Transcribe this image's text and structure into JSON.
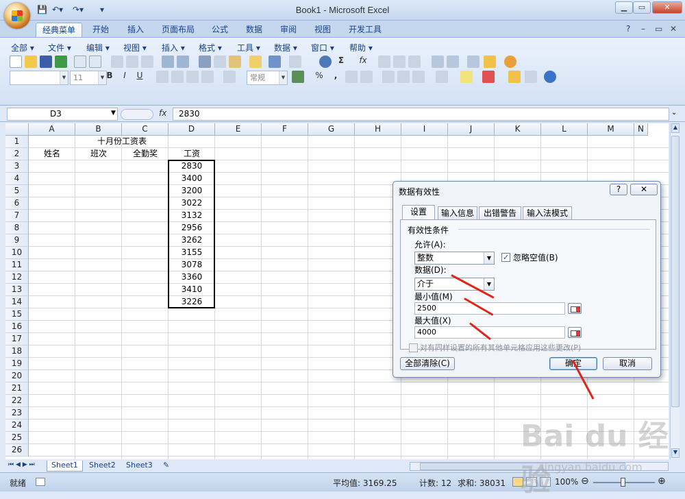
{
  "window": {
    "title": "Book1 - Microsoft Excel"
  },
  "ribbon_tabs": [
    "经典菜单",
    "开始",
    "插入",
    "页面布局",
    "公式",
    "数据",
    "审阅",
    "视图",
    "开发工具"
  ],
  "menus": [
    "全部",
    "文件",
    "编辑",
    "视图",
    "插入",
    "格式",
    "工具",
    "数据",
    "窗口",
    "帮助"
  ],
  "toolbar": {
    "font_size": "11",
    "number_format": "常规",
    "sum_symbol": "Σ",
    "fx_symbol": "fx",
    "bold": "B",
    "italic": "I",
    "underline": "U",
    "percent": "%",
    "comma": ","
  },
  "formula_bar": {
    "name_box": "D3",
    "fx": "fx",
    "formula": "2830"
  },
  "columns": [
    "A",
    "B",
    "C",
    "D",
    "E",
    "F",
    "G",
    "H",
    "I",
    "J",
    "K",
    "L",
    "M",
    "N"
  ],
  "rows": [
    "1",
    "2",
    "3",
    "4",
    "5",
    "6",
    "7",
    "8",
    "9",
    "10",
    "11",
    "12",
    "13",
    "14",
    "15",
    "16",
    "17",
    "18",
    "19",
    "20",
    "21",
    "22",
    "23",
    "24",
    "25",
    "26"
  ],
  "sheet": {
    "title": "十月份工资表",
    "headers": [
      "姓名",
      "班次",
      "全勤奖",
      "工资"
    ],
    "salaries": [
      "2830",
      "3400",
      "3200",
      "3022",
      "3132",
      "2956",
      "3262",
      "3155",
      "3078",
      "3360",
      "3410",
      "3226"
    ]
  },
  "sheet_tabs": [
    "Sheet1",
    "Sheet2",
    "Sheet3"
  ],
  "status_bar": {
    "mode": "就绪",
    "average": "平均值: 3169.25",
    "count": "计数: 12",
    "sum": "求和: 38031",
    "zoom": "100%"
  },
  "dialog": {
    "title": "数据有效性",
    "help": "?",
    "close": "✕",
    "tabs": [
      "设置",
      "输入信息",
      "出错警告",
      "输入法模式"
    ],
    "section": "有效性条件",
    "allow_label": "允许(A):",
    "allow_value": "整数",
    "ignore_blank_label": "忽略空值(B)",
    "data_label": "数据(D):",
    "data_value": "介于",
    "min_label": "最小值(M)",
    "min_value": "2500",
    "max_label": "最大值(X)",
    "max_value": "4000",
    "apply_all_label": "对有同样设置的所有其他单元格应用这些更改(P)",
    "clear_all": "全部清除(C)",
    "ok": "确定",
    "cancel": "取消"
  },
  "watermark": {
    "brand": "Bai du 经验",
    "url": "jingyan.baidu.com"
  },
  "colors": {
    "accent": "#15428b",
    "annotation_arrow": "#e2231a"
  }
}
